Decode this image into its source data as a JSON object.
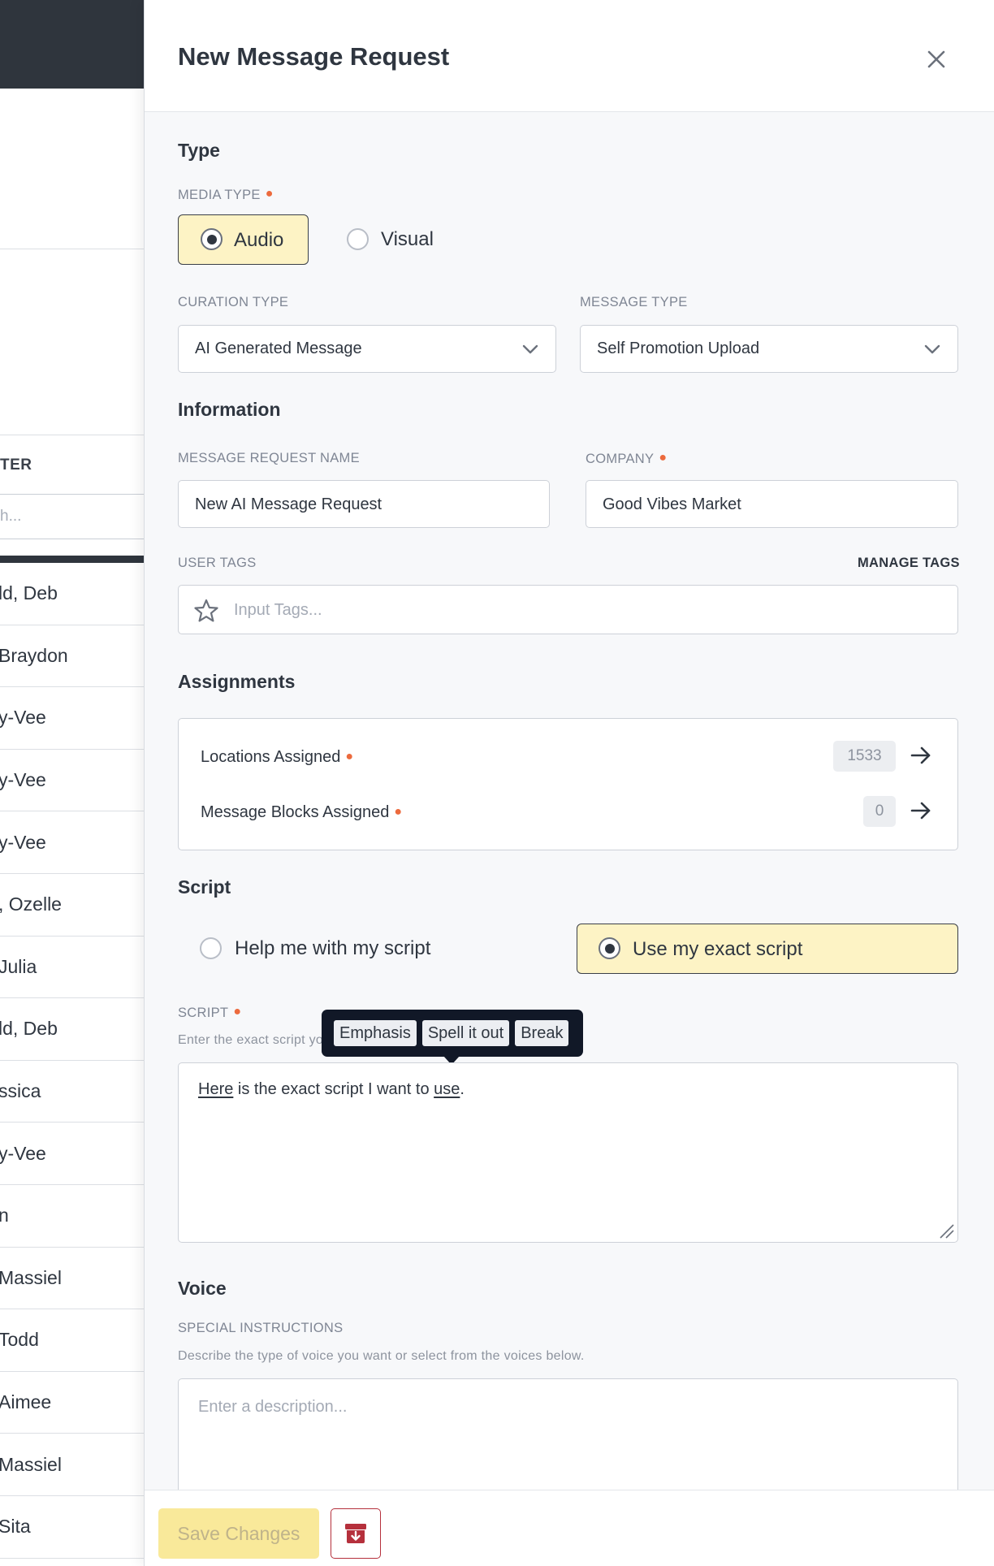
{
  "background_list": {
    "filter_label": "TER",
    "filter_placeholder": "h...",
    "rows": [
      "ld, Deb",
      "Braydon",
      "y-Vee",
      "y-Vee",
      "y-Vee",
      ", Ozelle",
      "Julia",
      "ld, Deb",
      "ssica",
      "y-Vee",
      "n",
      " Massiel",
      "Todd",
      "Aimee",
      " Massiel",
      " Sita"
    ]
  },
  "drawer": {
    "title": "New Message Request",
    "close_icon": "close-icon"
  },
  "type_section": {
    "title": "Type",
    "media_type_label": "MEDIA TYPE",
    "media_options": [
      {
        "label": "Audio",
        "selected": true
      },
      {
        "label": "Visual",
        "selected": false
      }
    ],
    "curation_type_label": "CURATION TYPE",
    "curation_type_value": "AI Generated Message",
    "message_type_label": "MESSAGE TYPE",
    "message_type_value": "Self Promotion Upload"
  },
  "information_section": {
    "title": "Information",
    "name_label": "MESSAGE REQUEST NAME",
    "name_value": "New AI Message Request",
    "company_label": "COMPANY",
    "company_value": "Good Vibes Market",
    "user_tags_label": "USER TAGS",
    "manage_tags": "MANAGE TAGS",
    "tags_placeholder": "Input Tags..."
  },
  "assignments_section": {
    "title": "Assignments",
    "locations_label": "Locations Assigned",
    "locations_count": "1533",
    "blocks_label": "Message Blocks Assigned",
    "blocks_count": "0"
  },
  "script_section": {
    "title": "Script",
    "help_option": "Help me with my script",
    "exact_option": "Use my exact script",
    "selected": "exact",
    "script_label": "SCRIPT",
    "script_hint": "Enter the exact script yo",
    "toolbar": [
      "Emphasis",
      "Spell it out",
      "Break"
    ],
    "script_text_before": " is the exact script I want to ",
    "script_word1": "Here",
    "script_word2": "use",
    "script_text_after": "."
  },
  "voice_section": {
    "title": "Voice",
    "instructions_label": "SPECIAL INSTRUCTIONS",
    "instructions_hint": "Describe the type of voice you want or select from the voices below.",
    "description_placeholder": "Enter a description..."
  },
  "footer": {
    "save_label": "Save Changes",
    "archive_icon": "archive-icon"
  },
  "colors": {
    "accent_yellow": "#fdf3c5",
    "save_yellow": "#f9e99a",
    "required_dot": "#ec6a3d",
    "danger": "#b5303c",
    "dark_header": "#2f353d"
  }
}
